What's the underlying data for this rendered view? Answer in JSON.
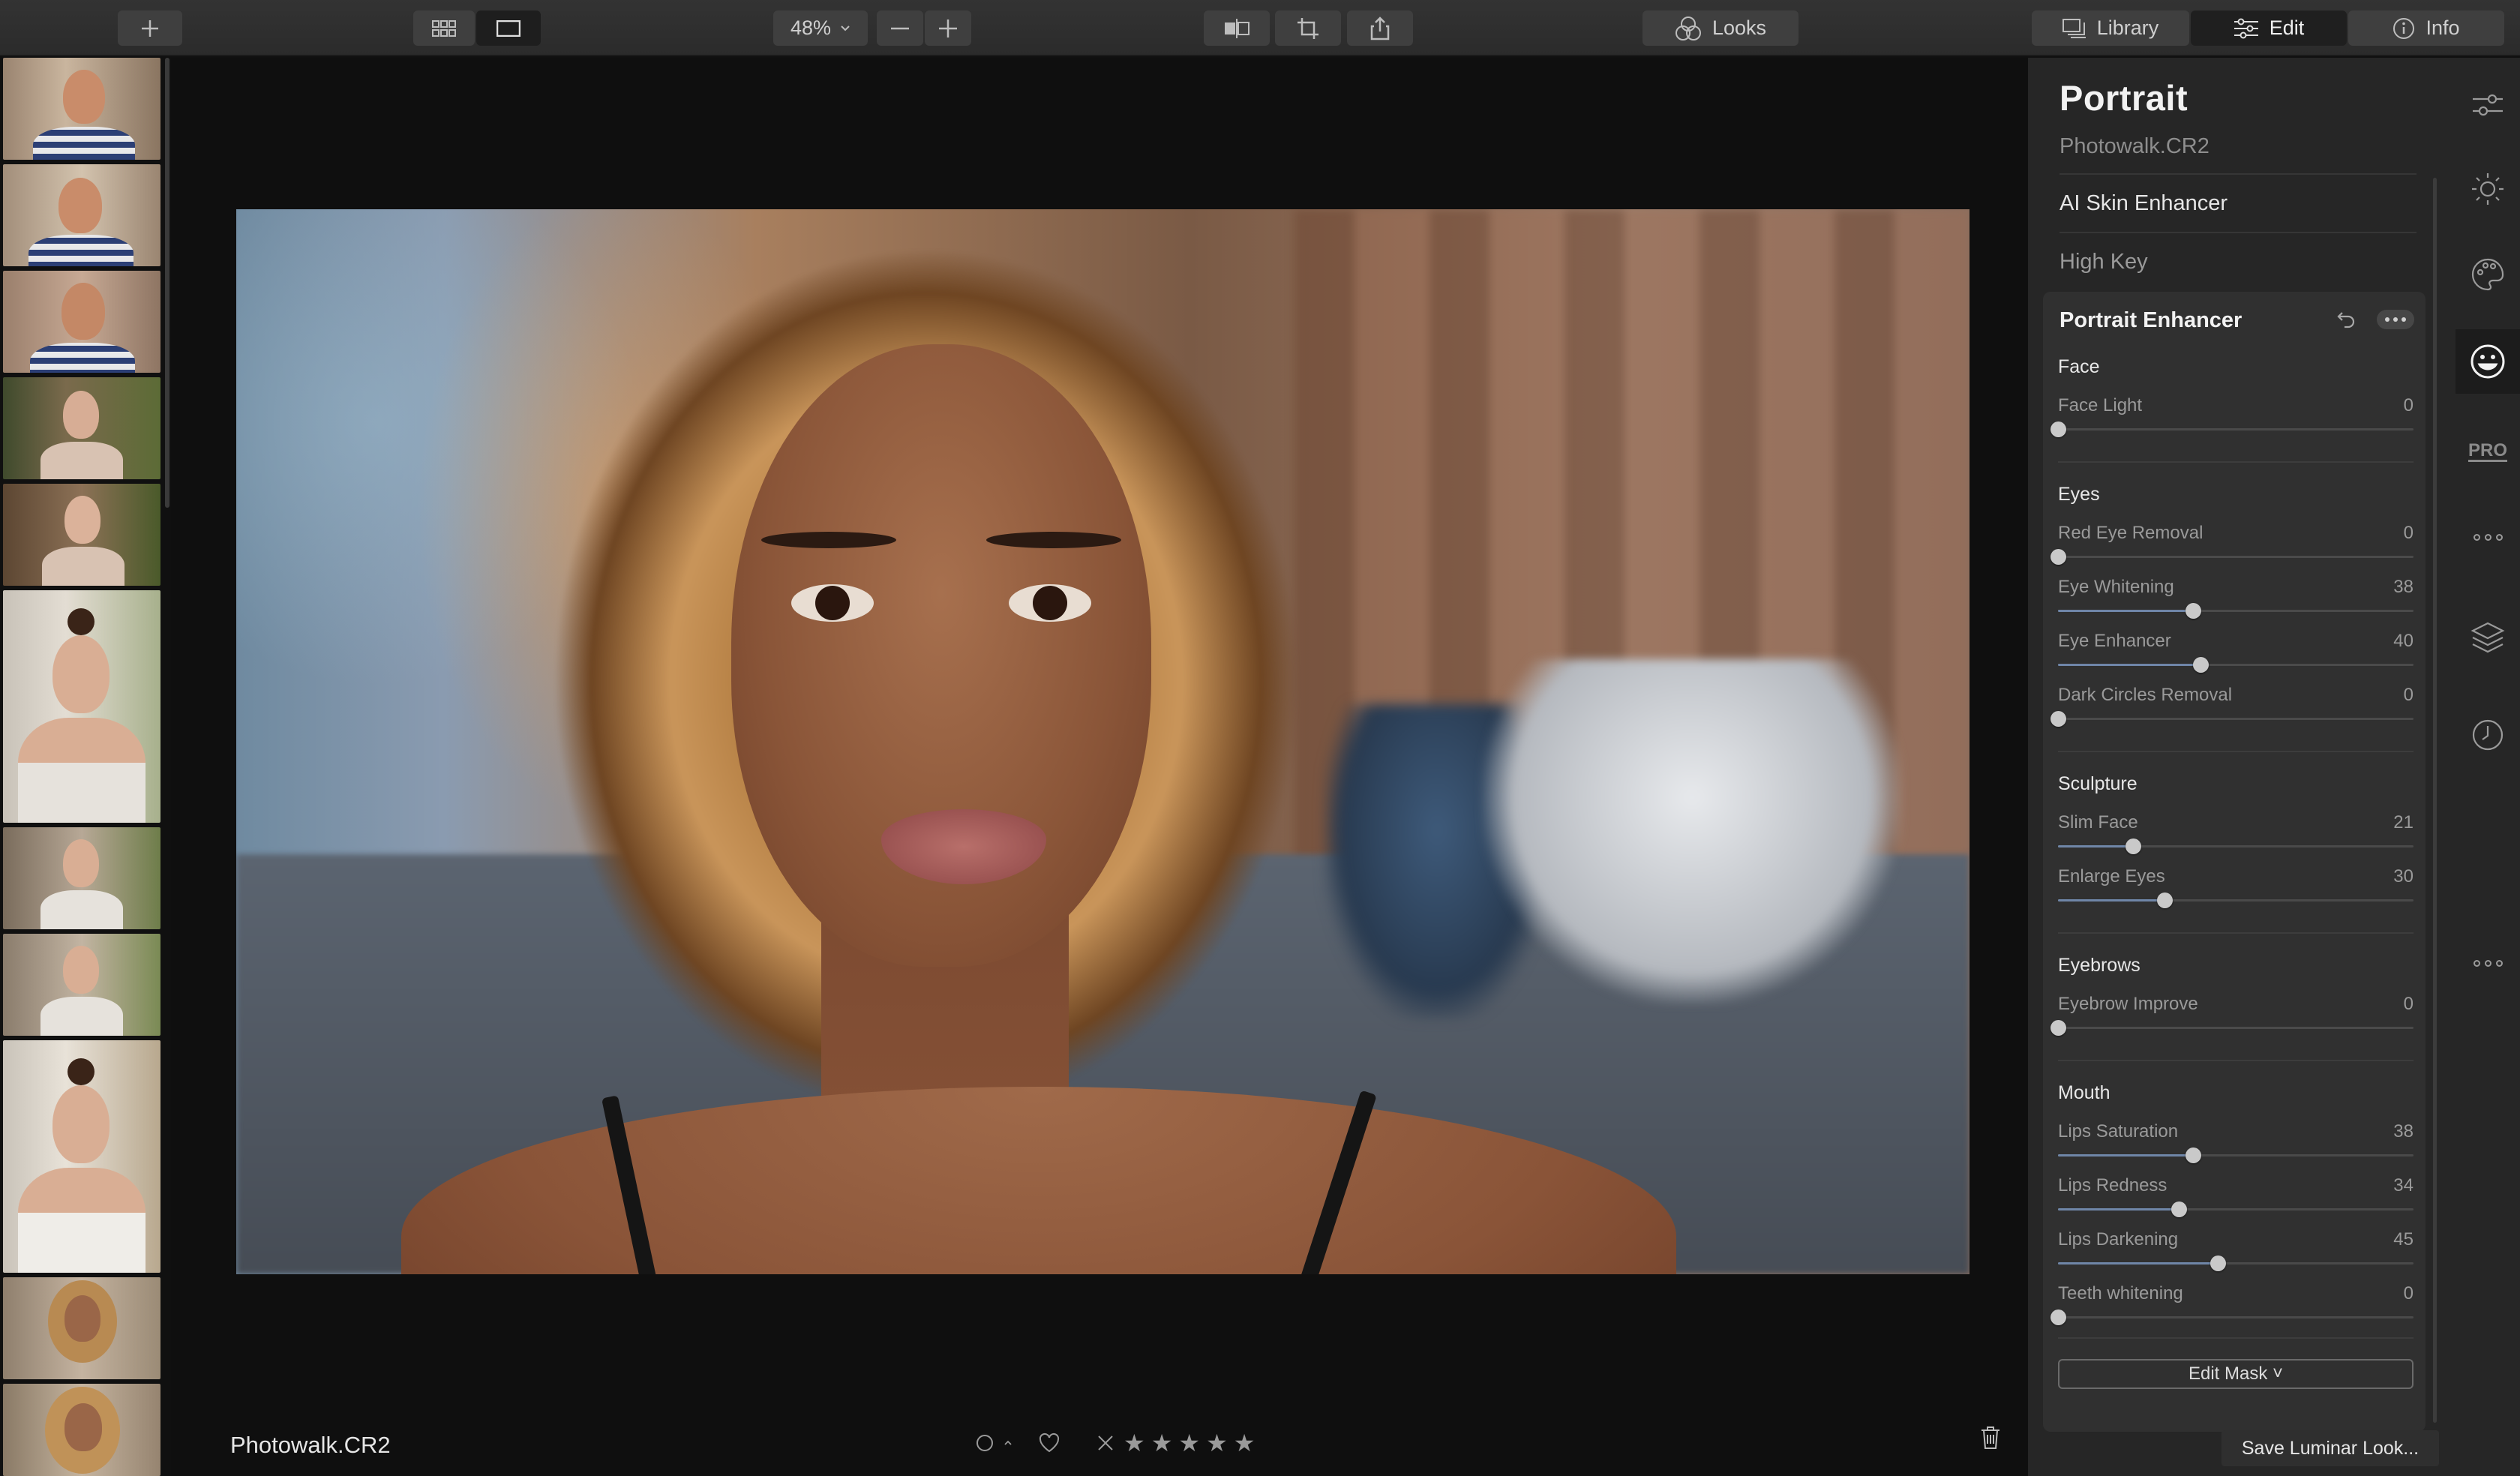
{
  "toolbar": {
    "add_icon": "plus-icon",
    "zoom_level": "48%",
    "looks_label": "Looks",
    "library_label": "Library",
    "edit_label": "Edit",
    "info_label": "Info"
  },
  "viewer": {
    "filename": "Photowalk.CR2"
  },
  "panel": {
    "title": "Portrait",
    "filename": "Photowalk.CR2",
    "tools": [
      "AI Skin Enhancer",
      "High Key"
    ],
    "active_tool": "Portrait Enhancer",
    "sections": {
      "face": {
        "title": "Face",
        "sliders": [
          {
            "label": "Face Light",
            "value": 0
          }
        ]
      },
      "eyes": {
        "title": "Eyes",
        "sliders": [
          {
            "label": "Red Eye Removal",
            "value": 0
          },
          {
            "label": "Eye Whitening",
            "value": 38
          },
          {
            "label": "Eye Enhancer",
            "value": 40
          },
          {
            "label": "Dark Circles Removal",
            "value": 0
          }
        ]
      },
      "sculpture": {
        "title": "Sculpture",
        "sliders": [
          {
            "label": "Slim Face",
            "value": 21
          },
          {
            "label": "Enlarge Eyes",
            "value": 30
          }
        ]
      },
      "eyebrows": {
        "title": "Eyebrows",
        "sliders": [
          {
            "label": "Eyebrow Improve",
            "value": 0
          }
        ]
      },
      "mouth": {
        "title": "Mouth",
        "sliders": [
          {
            "label": "Lips Saturation",
            "value": 38
          },
          {
            "label": "Lips Redness",
            "value": 34
          },
          {
            "label": "Lips Darkening",
            "value": 45
          },
          {
            "label": "Teeth whitening",
            "value": 0
          }
        ]
      }
    },
    "edit_mask_label": "Edit Mask ˅",
    "save_look_label": "Save Luminar Look..."
  },
  "rail": {
    "pro_label": "PRO"
  },
  "colors": {
    "accent": "#6f86a8",
    "panel_bg": "#262626",
    "card_bg": "#303030"
  }
}
